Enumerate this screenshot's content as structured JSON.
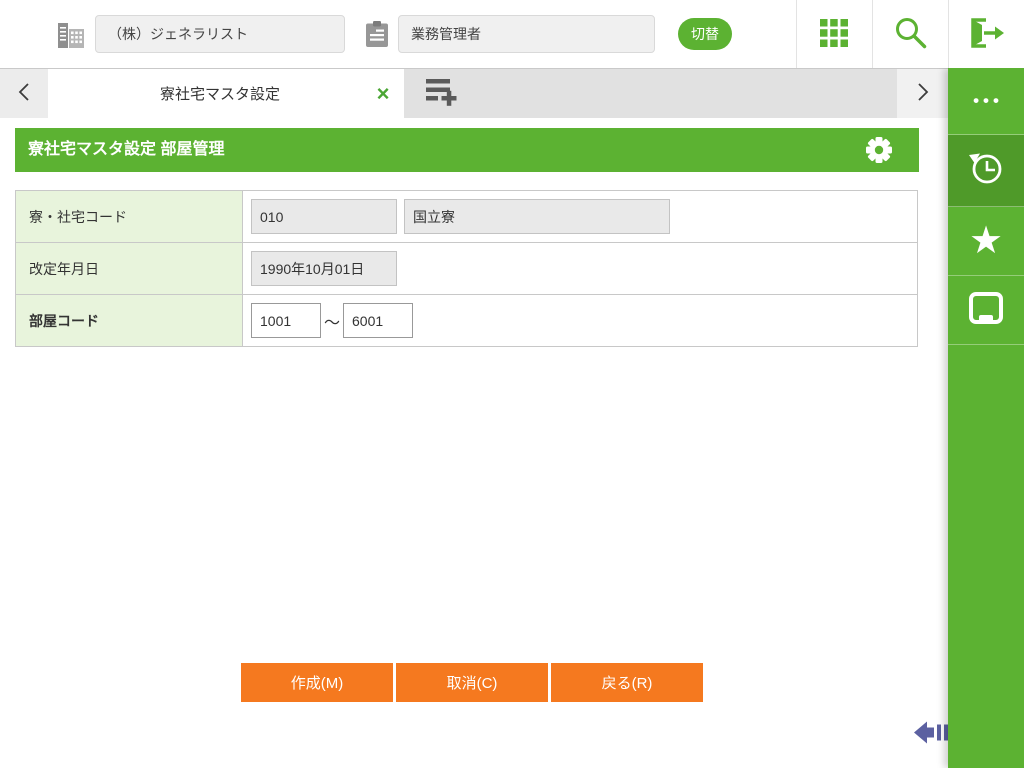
{
  "header": {
    "company_value": "（株）ジェネラリスト",
    "role_value": "業務管理者",
    "switch_label": "切替"
  },
  "tabbar": {
    "active_tab_label": "寮社宅マスタ設定"
  },
  "titlebar": {
    "title": "寮社宅マスタ設定 部屋管理"
  },
  "form": {
    "dorm_code": {
      "label": "寮・社宅コード",
      "code": "010",
      "name": "国立寮"
    },
    "revision_date": {
      "label": "改定年月日",
      "value": "1990年10月01日"
    },
    "room_code": {
      "label": "部屋コード",
      "from": "1001",
      "separator": "〜",
      "to": "6001"
    }
  },
  "buttons": {
    "create": "作成(M)",
    "cancel": "取消(C)",
    "back": "戻る(R)"
  },
  "icons": {
    "close": "×",
    "more_dots": "•••",
    "star": "★"
  },
  "colors": {
    "brand_green": "#5cb232",
    "sidebar_active_green": "#4f9a29",
    "label_bg_green": "#e8f4dc",
    "button_orange": "#f5791f",
    "collapse_arrow_blue": "#5c61a1"
  }
}
